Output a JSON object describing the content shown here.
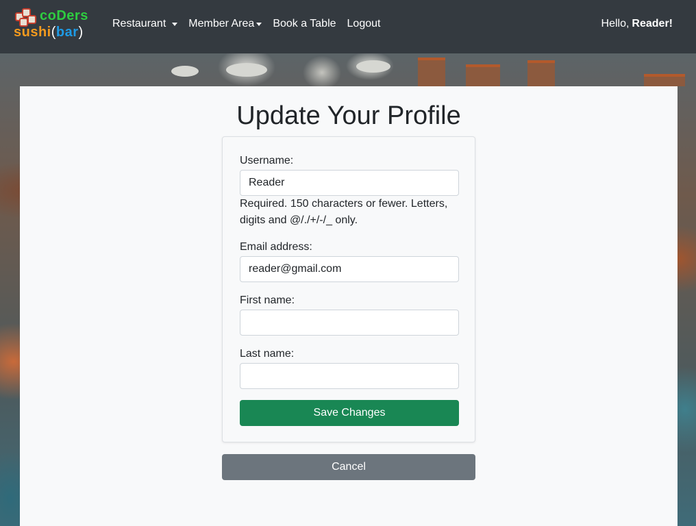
{
  "navbar": {
    "brand_line1": "coDers",
    "brand_sushi": "sushi",
    "brand_open_paren": "(",
    "brand_bar": "bar",
    "brand_close_paren": ")",
    "links": [
      {
        "label": "Restaurant",
        "dropdown": true
      },
      {
        "label": "Member Area",
        "dropdown": true
      },
      {
        "label": "Book a Table",
        "dropdown": false
      },
      {
        "label": "Logout",
        "dropdown": false
      }
    ],
    "greeting_prefix": "Hello,",
    "greeting_name": "Reader!"
  },
  "page": {
    "title": "Update Your Profile"
  },
  "form": {
    "username": {
      "label": "Username:",
      "value": "Reader"
    },
    "username_help": "Required. 150 characters or fewer. Letters, digits and @/./+/-/_ only.",
    "email": {
      "label": "Email address:",
      "value": "reader@gmail.com"
    },
    "first_name": {
      "label": "First name:",
      "value": ""
    },
    "last_name": {
      "label": "Last name:",
      "value": ""
    },
    "save_label": "Save Changes",
    "cancel_label": "Cancel"
  },
  "colors": {
    "navbar": "#343a40",
    "save_button": "#198754",
    "cancel_button": "#6c757d",
    "brand_green": "#2ecc40",
    "brand_orange": "#f39a1e",
    "brand_blue": "#1e9be6"
  }
}
